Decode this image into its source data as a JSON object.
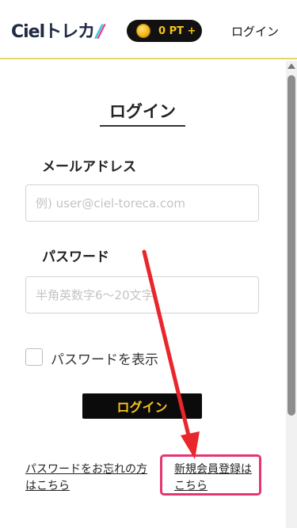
{
  "header": {
    "logo_text": "Cielトレカ",
    "points_label": "0 PT +",
    "login_label": "ログイン"
  },
  "form": {
    "title": "ログイン",
    "email_label": "メールアドレス",
    "email_placeholder": "例) user@ciel-toreca.com",
    "password_label": "パスワード",
    "password_placeholder": "半角英数字6〜20文字",
    "show_password_label": "パスワードを表示",
    "login_button": "ログイン"
  },
  "links": {
    "forgot_password": "パスワードをお忘れの方はこちら",
    "register": "新規会員登録はこちら"
  },
  "colors": {
    "accent_yellow": "#f7c31b",
    "header_border": "#e6d56a",
    "annotation_red": "#e8262c",
    "highlight_pink": "#e6356f"
  }
}
